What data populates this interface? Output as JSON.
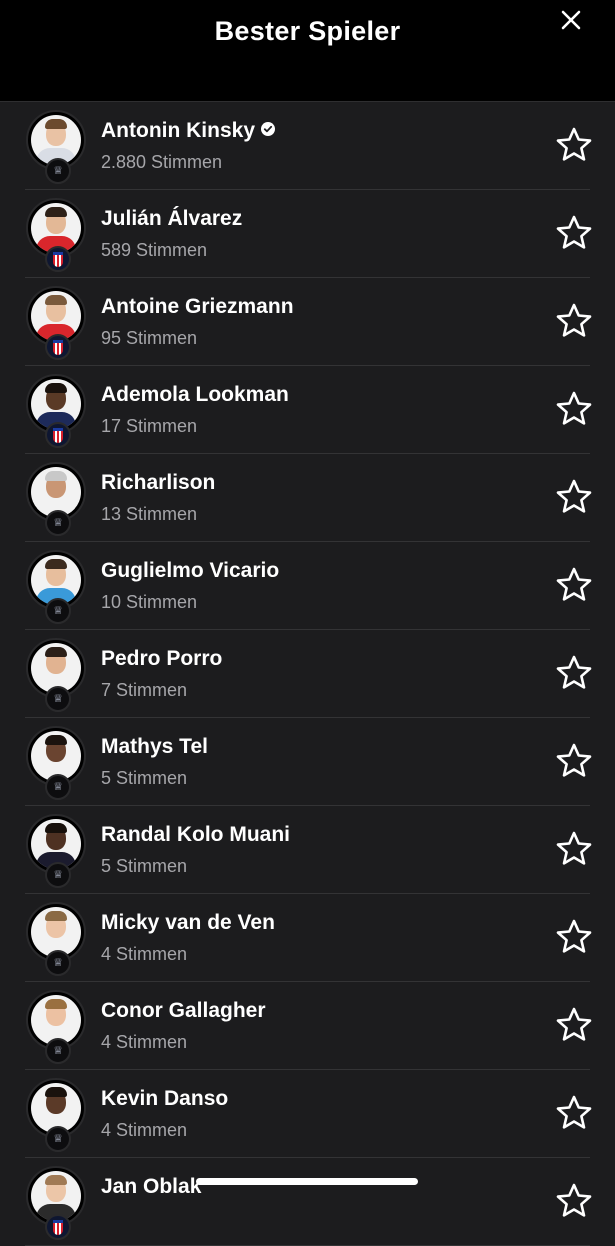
{
  "header": {
    "title": "Bester Spieler",
    "close_icon": "close-icon"
  },
  "colors": {
    "background": "#1c1c1e",
    "header": "#000000",
    "text": "#ffffff",
    "secondary_text": "#a6a6aa",
    "divider": "#333335"
  },
  "players": [
    {
      "name": "Antonin Kinsky",
      "votes": "2.880 Stimmen",
      "verified": true,
      "club": "spurs",
      "skin": "#e9c2a4",
      "hair": "#6b4a2e",
      "kit": "#d9dde5"
    },
    {
      "name": "Julián Álvarez",
      "votes": "589 Stimmen",
      "verified": false,
      "club": "atletico",
      "skin": "#e3b896",
      "hair": "#2e2118",
      "kit": "#d9262c"
    },
    {
      "name": "Antoine Griezmann",
      "votes": "95 Stimmen",
      "verified": false,
      "club": "atletico",
      "skin": "#e8c0a0",
      "hair": "#7a5a3c",
      "kit": "#d9262c"
    },
    {
      "name": "Ademola Lookman",
      "votes": "17 Stimmen",
      "verified": false,
      "club": "atletico",
      "skin": "#5a3a26",
      "hair": "#1a120d",
      "kit": "#1d2a5a"
    },
    {
      "name": "Richarlison",
      "votes": "13 Stimmen",
      "verified": false,
      "club": "spurs",
      "skin": "#c99674",
      "hair": "#c8c8c8",
      "kit": "#f2f2f2"
    },
    {
      "name": "Guglielmo Vicario",
      "votes": "10 Stimmen",
      "verified": false,
      "club": "spurs",
      "skin": "#e7be9d",
      "hair": "#3b2a1e",
      "kit": "#3a9ad9"
    },
    {
      "name": "Pedro Porro",
      "votes": "7 Stimmen",
      "verified": false,
      "club": "spurs",
      "skin": "#e1b391",
      "hair": "#2b1f17",
      "kit": "#f2f2f2"
    },
    {
      "name": "Mathys Tel",
      "votes": "5 Stimmen",
      "verified": false,
      "club": "spurs",
      "skin": "#6a4430",
      "hair": "#1b130e",
      "kit": "#f2f2f2"
    },
    {
      "name": "Randal Kolo Muani",
      "votes": "5 Stimmen",
      "verified": false,
      "club": "spurs",
      "skin": "#4e3122",
      "hair": "#17100b",
      "kit": "#1b1b2e"
    },
    {
      "name": "Micky van de Ven",
      "votes": "4 Stimmen",
      "verified": false,
      "club": "spurs",
      "skin": "#ecc4a6",
      "hair": "#8a6a45",
      "kit": "#f2f2f2"
    },
    {
      "name": "Conor Gallagher",
      "votes": "4 Stimmen",
      "verified": false,
      "club": "spurs",
      "skin": "#ecc1a2",
      "hair": "#9a7040",
      "kit": "#f2f2f2"
    },
    {
      "name": "Kevin Danso",
      "votes": "4 Stimmen",
      "verified": false,
      "club": "spurs",
      "skin": "#5b3a28",
      "hair": "#1a120d",
      "kit": "#f2f2f2"
    },
    {
      "name": "Jan Oblak",
      "votes": "",
      "verified": false,
      "club": "atletico",
      "skin": "#ecc6a8",
      "hair": "#a07a55",
      "kit": "#2b2b2b"
    }
  ]
}
